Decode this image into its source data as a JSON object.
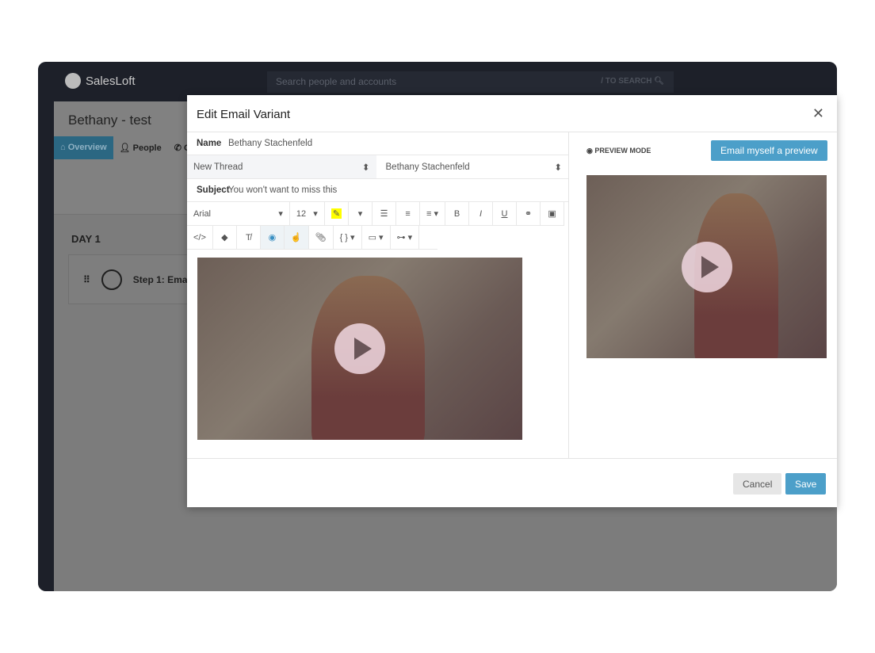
{
  "app": {
    "brand": "SalesLoft",
    "search_placeholder": "Search people and accounts",
    "search_hint": "/ TO SEARCH"
  },
  "page": {
    "title": "Bethany - test",
    "tabs": [
      {
        "label": "Overview"
      },
      {
        "label": "People"
      },
      {
        "label": "C"
      }
    ],
    "day": "DAY 1",
    "step": "Step 1: Ema"
  },
  "modal": {
    "title": "Edit Email Variant",
    "name_label": "Name",
    "name_value": "Bethany Stachenfeld",
    "thread": "New Thread",
    "sender": "Bethany Stachenfeld",
    "subject_label": "Subject",
    "subject_value": "You won't want to miss this",
    "font": "Arial",
    "size": "12",
    "preview_mode": "PREVIEW MODE",
    "email_preview": "Email myself a preview",
    "cancel": "Cancel",
    "save": "Save"
  },
  "colors": {
    "accent": "#4c9fc9",
    "topbar": "#1d2029"
  }
}
